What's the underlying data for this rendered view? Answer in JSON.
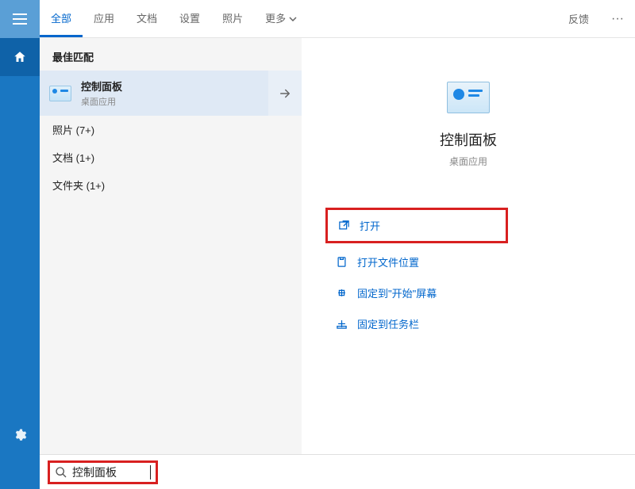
{
  "tabs": {
    "all": "全部",
    "apps": "应用",
    "docs": "文档",
    "settings": "设置",
    "photos": "照片",
    "more": "更多",
    "feedback": "反馈"
  },
  "section": {
    "best_match": "最佳匹配"
  },
  "result": {
    "title": "控制面板",
    "subtitle": "桌面应用"
  },
  "categories": {
    "photos": "照片 (7+)",
    "docs": "文档 (1+)",
    "folders": "文件夹 (1+)"
  },
  "details": {
    "title": "控制面板",
    "subtitle": "桌面应用"
  },
  "actions": {
    "open": "打开",
    "open_location": "打开文件位置",
    "pin_start": "固定到\"开始\"屏幕",
    "pin_taskbar": "固定到任务栏"
  },
  "search": {
    "value": "控制面板"
  }
}
